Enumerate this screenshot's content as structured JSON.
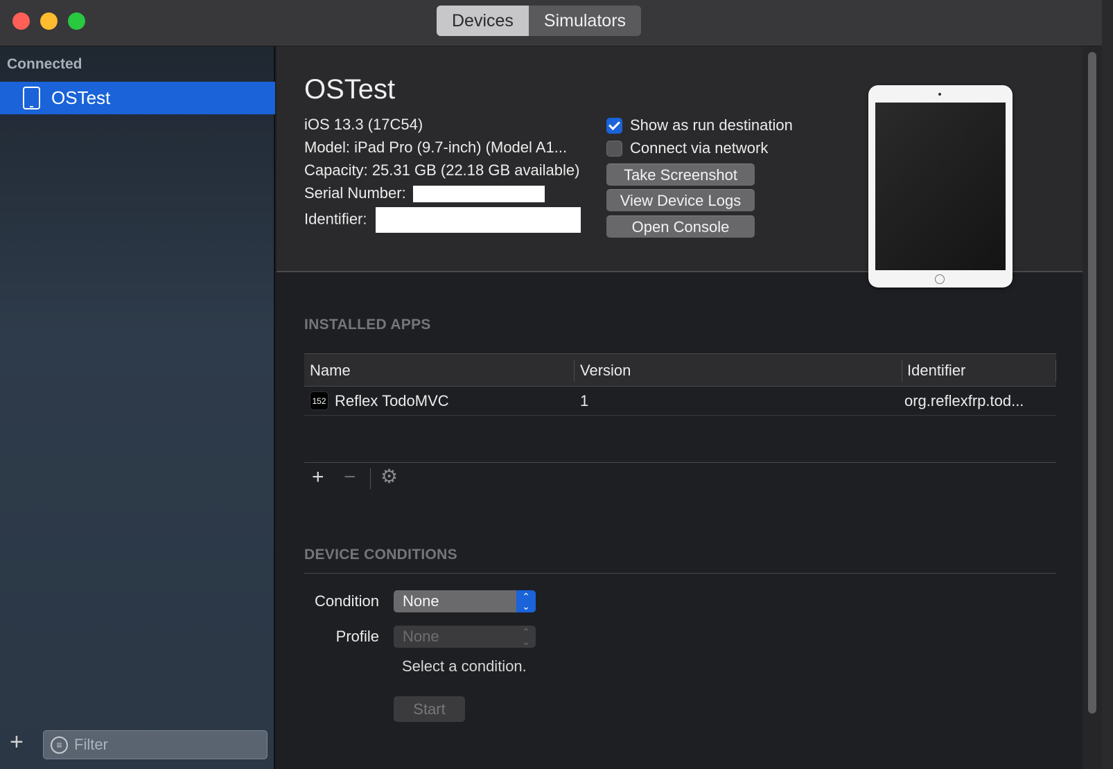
{
  "toolbar": {
    "segments": [
      "Devices",
      "Simulators"
    ],
    "selected": "Devices"
  },
  "sidebar": {
    "section": "Connected",
    "items": [
      {
        "label": "OSTest",
        "icon": "ipad-icon"
      }
    ],
    "filter_placeholder": "Filter"
  },
  "device": {
    "name": "OSTest",
    "ios": "iOS 13.3 (17C54)",
    "model": "Model: iPad Pro (9.7-inch) (Model A1...",
    "capacity": "Capacity: 25.31 GB (22.18 GB available)",
    "serial_label": "Serial Number:",
    "identifier_label": "Identifier:",
    "show_run_destination": "Show as run destination",
    "connect_network": "Connect via network",
    "buttons": [
      "Take Screenshot",
      "View Device Logs",
      "Open Console"
    ]
  },
  "installed_apps": {
    "title": "INSTALLED APPS",
    "columns": [
      "Name",
      "Version",
      "Identifier"
    ],
    "rows": [
      {
        "icon_text": "152",
        "name": "Reflex TodoMVC",
        "version": "1",
        "identifier": "org.reflexfrp.tod..."
      }
    ]
  },
  "conditions": {
    "title": "DEVICE CONDITIONS",
    "condition_label": "Condition",
    "condition_value": "None",
    "profile_label": "Profile",
    "profile_value": "None",
    "hint": "Select a condition.",
    "start_label": "Start"
  },
  "colors": {
    "accent": "#1a63d8",
    "sidebar_selected": "#1a63d8"
  }
}
